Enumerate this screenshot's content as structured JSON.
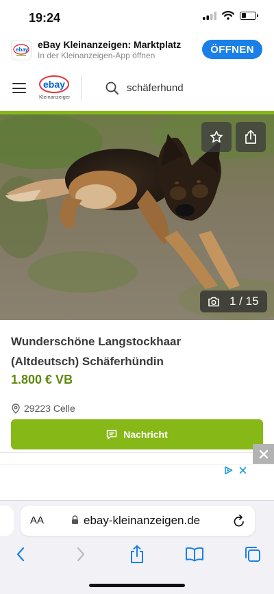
{
  "status_bar": {
    "time": "19:24"
  },
  "app_banner": {
    "title": "eBay Kleinanzeigen: Marktplatz",
    "subtitle": "In der Kleinanzeigen-App öffnen",
    "open_label": "ÖFFNEN",
    "icon": "ebay-kleinanzeigen-app-icon"
  },
  "header": {
    "logo_text": "ebay",
    "logo_subtext": "Kleinanzeigen",
    "search_value": "schäferhund"
  },
  "photo": {
    "counter": "1 / 15",
    "favorite_icon": "star-icon",
    "share_icon": "share-icon"
  },
  "listing": {
    "title": "Wunderschöne Langstockhaar (Altdeutsch) Schäferhündin",
    "price": "1.800 € VB",
    "location": "29223 Celle",
    "message_button": "Nachricht"
  },
  "safari": {
    "aa_label": "AA",
    "url": "ebay-kleinanzeigen.de"
  },
  "colors": {
    "brand_green": "#86b817",
    "price_green": "#5e8a10",
    "ios_blue": "#1a7fe8"
  }
}
